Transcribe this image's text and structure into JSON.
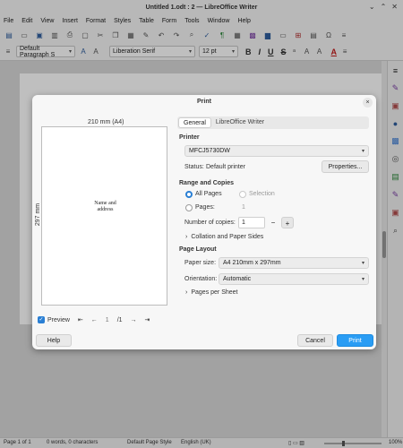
{
  "app": {
    "window_title": "Untitled 1.odt : 2 — LibreOffice Writer",
    "menu": [
      "File",
      "Edit",
      "View",
      "Insert",
      "Format",
      "Styles",
      "Table",
      "Form",
      "Tools",
      "Window",
      "Help"
    ]
  },
  "format_toolbar": {
    "paragraph_style": "Default Paragraph S",
    "font_name": "Liberation Serif",
    "font_size": "12 pt",
    "bold": "B",
    "italic": "I",
    "underline": "U",
    "strike": "S",
    "font_color_glyph": "A"
  },
  "statusbar": {
    "page": "Page 1 of 1",
    "words": "0 words, 0 characters",
    "page_style": "Default Page Style",
    "language": "English (UK)",
    "zoom": "100%"
  },
  "dialog": {
    "title": "Print",
    "close": "×",
    "preview": {
      "width_label": "210 mm (A4)",
      "height_label": "297 mm",
      "address_line1": "Name and",
      "address_line2": "address",
      "preview_label": "Preview",
      "page_current": "1",
      "page_total": "/1"
    },
    "tabs": [
      "General",
      "LibreOffice Writer"
    ],
    "printer": {
      "section": "Printer",
      "selected": "MFCJ5730DW",
      "status_label": "Status:",
      "status_value": "Default printer",
      "properties_button": "Properties..."
    },
    "range": {
      "section": "Range and Copies",
      "all_pages": "All Pages",
      "selection": "Selection",
      "pages_label": "Pages:",
      "pages_value": "1",
      "copies_label": "Number of copies:",
      "copies_value": "1",
      "minus": "−",
      "plus": "+",
      "collation_expander": "Collation and Paper Sides"
    },
    "layout": {
      "section": "Page Layout",
      "paper_size_label": "Paper size:",
      "paper_size_value": "A4 210mm x 297mm",
      "orientation_label": "Orientation:",
      "orientation_value": "Automatic",
      "pages_per_sheet_expander": "Pages per Sheet"
    },
    "buttons": {
      "help": "Help",
      "cancel": "Cancel",
      "print": "Print"
    }
  }
}
